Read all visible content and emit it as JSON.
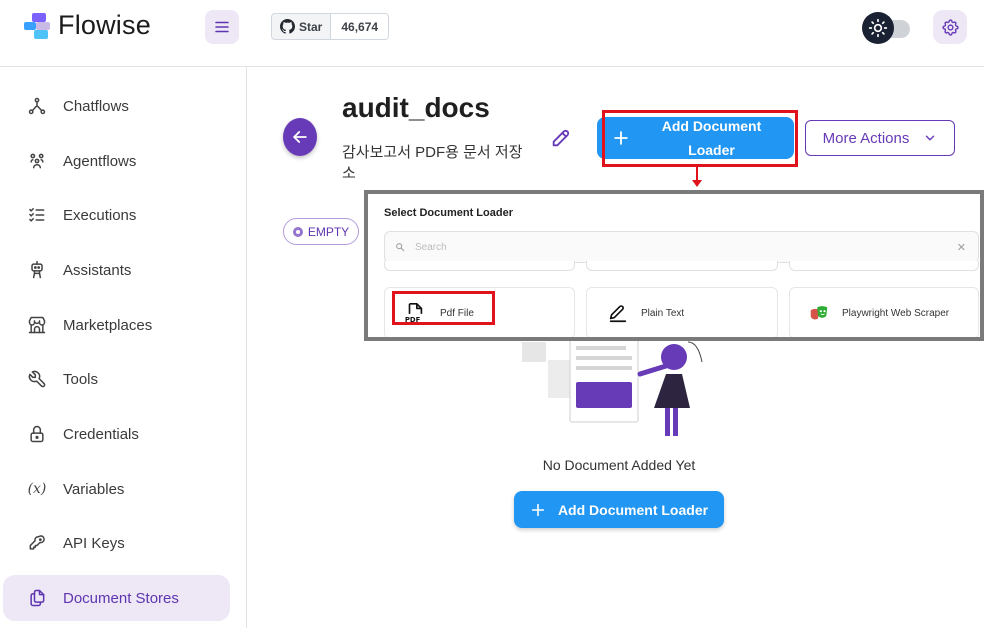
{
  "app": {
    "name": "Flowise",
    "github": {
      "star_label": "Star",
      "star_count": "46,674"
    }
  },
  "sidebar": {
    "items": [
      {
        "label": "Chatflows",
        "icon": "hierarchy-icon",
        "active": false
      },
      {
        "label": "Agentflows",
        "icon": "users-group-icon",
        "active": false
      },
      {
        "label": "Executions",
        "icon": "list-check-icon",
        "active": false
      },
      {
        "label": "Assistants",
        "icon": "robot-icon",
        "active": false
      },
      {
        "label": "Marketplaces",
        "icon": "building-store-icon",
        "active": false
      },
      {
        "label": "Tools",
        "icon": "tool-icon",
        "active": false
      },
      {
        "label": "Credentials",
        "icon": "lock-icon",
        "active": false
      },
      {
        "label": "Variables",
        "icon": "variable-icon",
        "active": false
      },
      {
        "label": "API Keys",
        "icon": "key-icon",
        "active": false
      },
      {
        "label": "Document Stores",
        "icon": "files-icon",
        "active": true
      }
    ]
  },
  "store": {
    "title": "audit_docs",
    "description": "감사보고서 PDF용 문서 저장소",
    "status": "EMPTY",
    "add_loader_label": "Add Document Loader",
    "more_actions_label": "More Actions"
  },
  "loader_dialog": {
    "title": "Select Document Loader",
    "search_placeholder": "Search",
    "loaders": [
      {
        "label": "Pdf File",
        "icon": "pdf-file-icon"
      },
      {
        "label": "Plain Text",
        "icon": "pencil-icon"
      },
      {
        "label": "Playwright Web Scraper",
        "icon": "playwright-icon"
      }
    ]
  },
  "empty_state": {
    "message": "No Document Added Yet",
    "button_label": "Add Document Loader"
  },
  "colors": {
    "primary": "#673ab7",
    "accent_blue": "#2196f3",
    "highlight_red": "#e0121b",
    "active_bg": "#ede7f6"
  }
}
